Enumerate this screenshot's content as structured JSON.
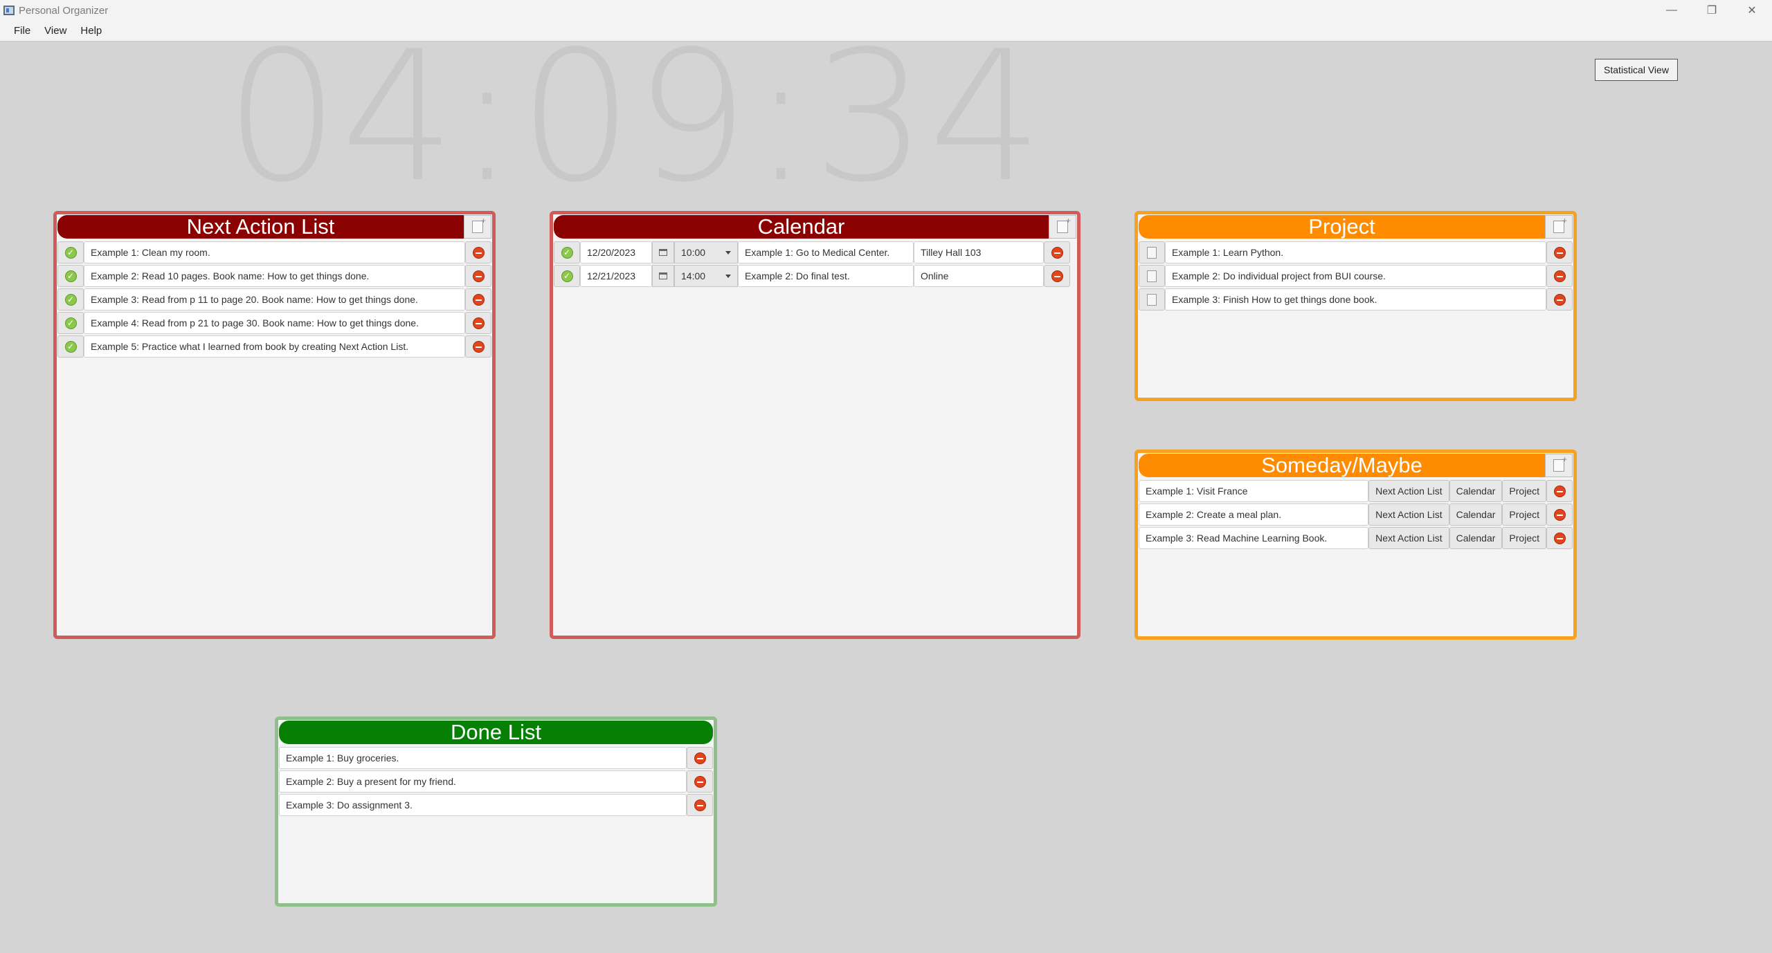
{
  "window": {
    "title": "Personal Organizer",
    "minimize": "—",
    "restore": "❐",
    "close": "✕"
  },
  "menu": {
    "file": "File",
    "view": "View",
    "help": "Help"
  },
  "clock": "04:09:34",
  "stat_button": "Statistical View",
  "next_action": {
    "title": "Next Action List",
    "items": [
      "Example 1: Clean my room.",
      "Example 2: Read 10 pages. Book name: How to get things done.",
      "Example 3: Read from p 11 to page 20. Book name: How to get things done.",
      "Example 4: Read from p 21 to page 30. Book name: How to get things done.",
      "Example 5: Practice what I learned from book by creating Next Action List."
    ]
  },
  "calendar": {
    "title": "Calendar",
    "items": [
      {
        "date": "12/20/2023",
        "time": "10:00",
        "task": "Example 1: Go to Medical Center.",
        "location": "Tilley Hall 103"
      },
      {
        "date": "12/21/2023",
        "time": "14:00",
        "task": "Example 2: Do final test.",
        "location": "Online"
      }
    ]
  },
  "project": {
    "title": "Project",
    "items": [
      "Example 1: Learn Python.",
      "Example 2: Do individual project from BUI course.",
      "Example 3: Finish How to get things done book."
    ]
  },
  "someday": {
    "title": "Someday/Maybe",
    "move_next": "Next Action List",
    "move_calendar": "Calendar",
    "move_project": "Project",
    "items": [
      "Example 1: Visit France",
      "Example 2: Create a meal plan.",
      "Example 3: Read Machine Learning Book."
    ]
  },
  "done": {
    "title": "Done List",
    "items": [
      "Example 1: Buy groceries.",
      "Example 2: Buy a present for my friend.",
      "Example 3: Do assignment 3."
    ]
  },
  "colors": {
    "red_header": "#8b0000",
    "orange_header": "#ff8c00",
    "green_header": "#058005"
  }
}
